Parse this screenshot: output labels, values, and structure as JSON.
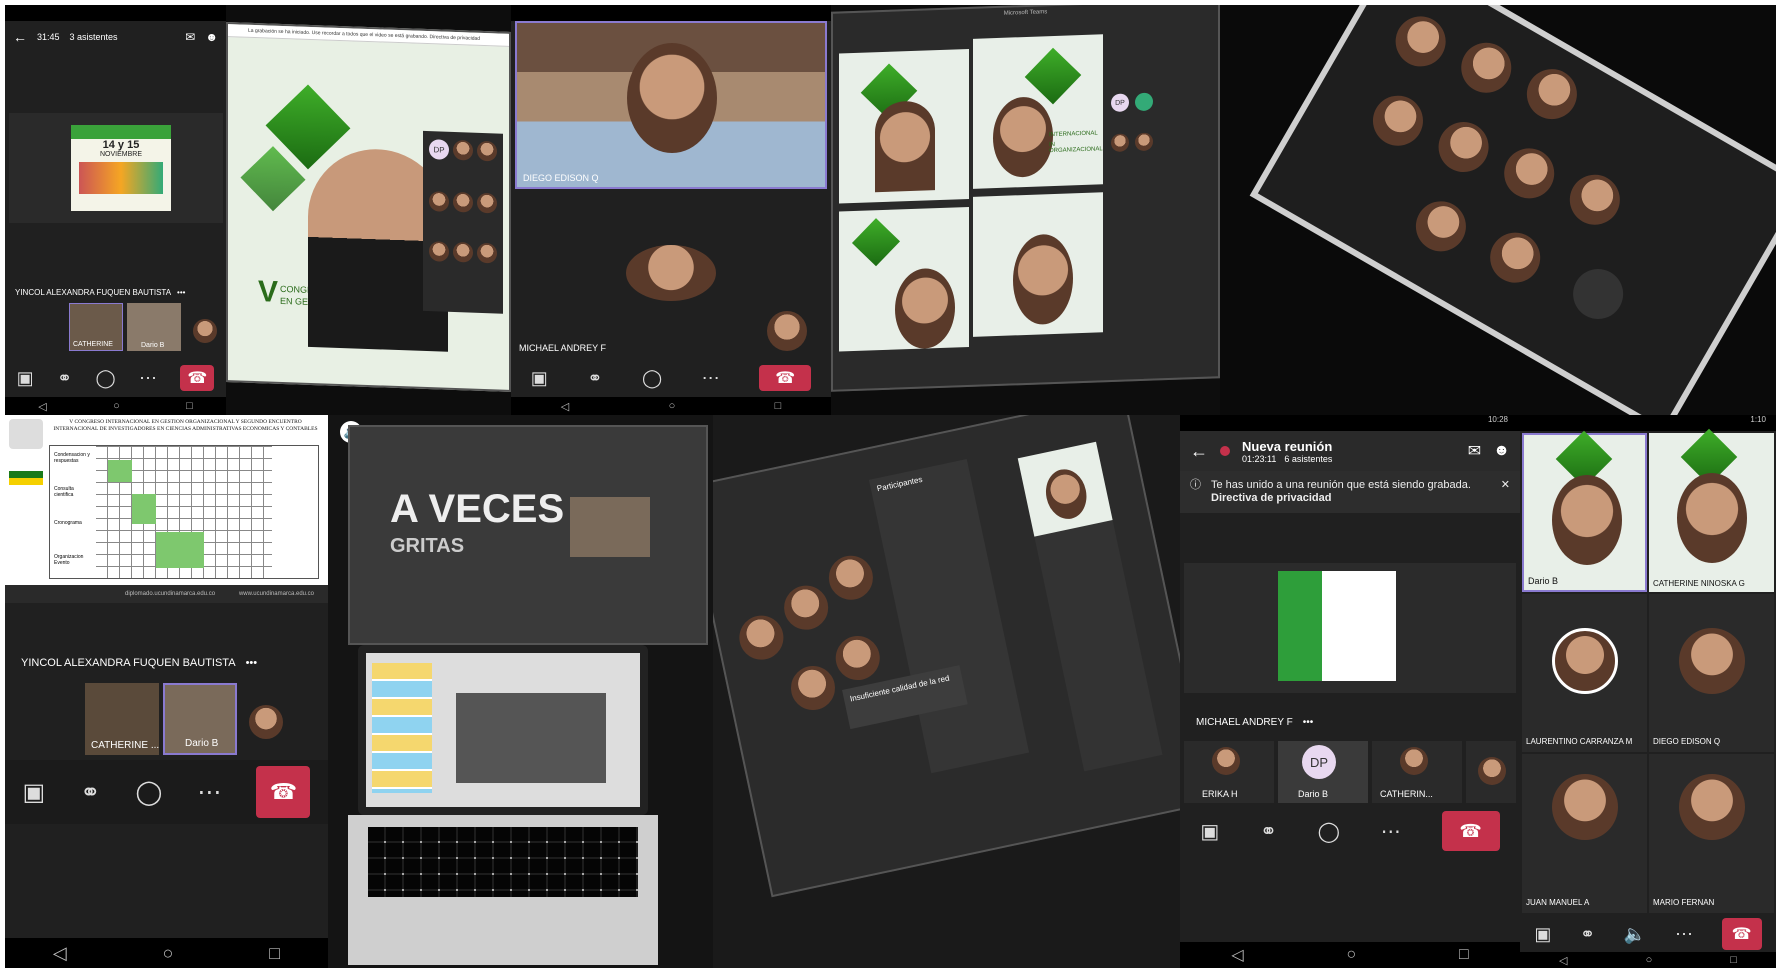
{
  "tile1": {
    "time": "31:45",
    "attendees": "3 asistentes",
    "poster_lines": [
      "14 y 15",
      "NOVIEMBRE"
    ],
    "speaker": "YINCOL ALEXANDRA FUQUEN BAUTISTA",
    "more": "•••",
    "thumbs": [
      "CATHERINE",
      "Dario B"
    ]
  },
  "tile2": {
    "banner": "La grabación se ha iniciado. Use recordar a todos que el video se está grabando. Directiva de privacidad",
    "participants_initials": "DP",
    "congress_big": "V",
    "congress_text": [
      "CONGRE",
      "EN GEST"
    ]
  },
  "tile3": {
    "top_name": "DIEGO EDISON Q",
    "bottom_name": "MICHAEL ANDREY F"
  },
  "tile4": {
    "title": "Microsoft Teams",
    "initials": "DP",
    "congress": [
      "INTERNACIONAL",
      "IN ORGANIZACIONAL"
    ]
  },
  "tile6": {
    "doc_heading": "V CONGRESO INTERNACIONAL EN GESTION ORGANIZACIONAL Y SEGUNDO ENCUENTRO INTERNACIONAL DE INVESTIGADORES EN CIENCIAS ADMINISTRATIVAS ECONOMICAS Y CONTABLES",
    "doc_rows": [
      "Condensacion y respuestas",
      "Consulta cientifica",
      "Cronograma",
      "Organizacion Evento"
    ],
    "footer_left": "diplomado.ucundinamarca.edu.co",
    "footer_right": "www.ucundinamarca.edu.co",
    "speaker": "YINCOL ALEXANDRA FUQUEN BAUTISTA",
    "more": "•••",
    "thumbs": [
      "CATHERINE ...",
      "Dario B"
    ]
  },
  "tile7": {
    "big_text": "A VECES",
    "sub_text": "GRITAS"
  },
  "tile8": {
    "panel_title": "Participantes",
    "popup": "Insuficiente calidad de la red"
  },
  "tile9": {
    "time": "10:28",
    "title": "Nueva reunión",
    "timer": "01:23:11",
    "attendees": "6 asistentes",
    "banner_text": "Te has unido a una reunión que está siendo grabada.",
    "banner_link": "Directiva de privacidad",
    "speaker": "MICHAEL ANDREY F",
    "more": "•••",
    "thumbs": [
      {
        "name": "ERIKA H",
        "initials": ""
      },
      {
        "name": "Dario B",
        "initials": "DP"
      },
      {
        "name": "CATHERIN...",
        "initials": ""
      }
    ]
  },
  "tile10": {
    "time": "1:10",
    "participants": [
      {
        "name": "Dario B"
      },
      {
        "name": "CATHERINE NINOSKA G"
      },
      {
        "name": "LAURENTINO CARRANZA M"
      },
      {
        "name": "DIEGO EDISON Q"
      },
      {
        "name": "JUAN MANUEL A"
      },
      {
        "name": "MARIO FERNAN"
      }
    ]
  },
  "colors": {
    "teams_dark": "#1f1f1f",
    "hangup_red": "#c4314b",
    "congress_green": "#3fae29"
  }
}
